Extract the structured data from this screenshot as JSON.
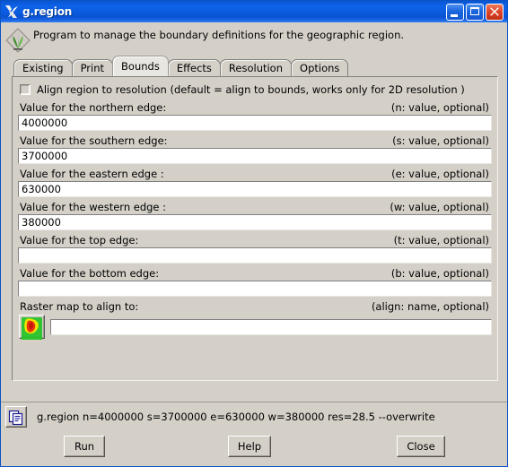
{
  "window": {
    "title": "g.region",
    "icon": "x11-icon",
    "controls": {
      "minimize": "minimize-button",
      "maximize": "maximize-button",
      "close": "close-button"
    }
  },
  "header": {
    "logo": "grass-gis-logo",
    "description": "Program to manage the boundary definitions for the geographic region."
  },
  "tabs": [
    {
      "label": "Existing",
      "selected": false
    },
    {
      "label": "Print",
      "selected": false
    },
    {
      "label": "Bounds",
      "selected": true
    },
    {
      "label": "Effects",
      "selected": false
    },
    {
      "label": "Resolution",
      "selected": false
    },
    {
      "label": "Options",
      "selected": false
    }
  ],
  "panel": {
    "align_checkbox": {
      "label": "Align region to resolution (default = align to bounds, works only for 2D resolution )",
      "checked": false
    },
    "fields": [
      {
        "label": "Value for the northern edge:",
        "hint": "(n:  value, optional)",
        "value": "4000000"
      },
      {
        "label": "Value for the southern edge:",
        "hint": "(s:  value, optional)",
        "value": "3700000"
      },
      {
        "label": "Value for the eastern edge :",
        "hint": "(e:  value, optional)",
        "value": "630000"
      },
      {
        "label": "Value for the western edge :",
        "hint": "(w:  value, optional)",
        "value": "380000"
      },
      {
        "label": "Value for the top edge:",
        "hint": "(t:  value, optional)",
        "value": ""
      },
      {
        "label": "Value for the bottom edge:",
        "hint": "(b:  value, optional)",
        "value": ""
      }
    ],
    "align_map": {
      "label": "Raster map to align to:",
      "hint": "(align:  name, optional)",
      "value": "",
      "button_icon": "raster-map-icon"
    }
  },
  "command_bar": {
    "copy_icon": "copy-icon",
    "command": "g.region n=4000000 s=3700000 e=630000 w=380000 res=28.5 --overwrite"
  },
  "buttons": {
    "run": "Run",
    "help": "Help",
    "close": "Close"
  },
  "colors": {
    "titlebar_blue": "#0b5ce0",
    "close_red": "#c22f14",
    "face": "#d4d0c8",
    "tab_selected": "#e8e6e1",
    "field_bg": "#ffffff"
  }
}
